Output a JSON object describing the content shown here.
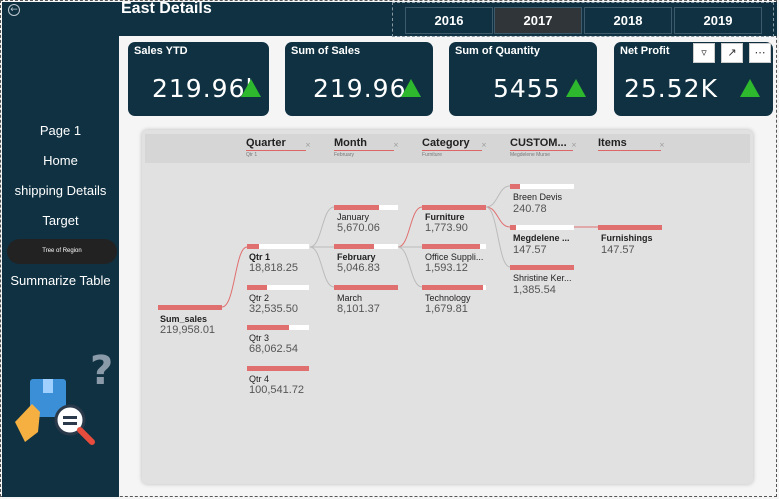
{
  "header": {
    "title": "East Details"
  },
  "years": [
    "2016",
    "2017",
    "2018",
    "2019"
  ],
  "selected_year": "2017",
  "sidebar": {
    "items": [
      {
        "label": "Page 1"
      },
      {
        "label": "Home"
      },
      {
        "label": "shipping Details"
      },
      {
        "label": "Target"
      },
      {
        "label": "Tree of Region"
      },
      {
        "label": "Summarize Table"
      }
    ],
    "selected": "Tree of Region",
    "back_icon": "back-arrow-icon",
    "illustration_icon": "help-search-illustration-icon"
  },
  "cards": [
    {
      "label": "Sales YTD",
      "value": "219.96l"
    },
    {
      "label": "Sum of Sales",
      "value": "219.96"
    },
    {
      "label": "Sum of Quantity",
      "value": "5455"
    },
    {
      "label": "Net Profit",
      "value": "25.52K"
    }
  ],
  "card_trend_icon": "up-triangle-icon",
  "card_trend_color": "#2eb82e",
  "visual_icons": [
    "filter-icon",
    "focus-mode-icon",
    "more-options-icon"
  ],
  "tree": {
    "columns": [
      {
        "label": "Quarter",
        "sub": "Qtr 1"
      },
      {
        "label": "Month",
        "sub": "February"
      },
      {
        "label": "Category",
        "sub": "Furniture"
      },
      {
        "label": "CUSTOM...",
        "sub": "Megdelene Murse"
      },
      {
        "label": "Items",
        "sub": ""
      }
    ],
    "root": {
      "label": "Sum_sales",
      "value": "219,958.01"
    },
    "quarters": [
      {
        "label": "Qtr 1",
        "value": "18,818.25",
        "fill": 0.19
      },
      {
        "label": "Qtr 2",
        "value": "32,535.50",
        "fill": 0.32
      },
      {
        "label": "Qtr 3",
        "value": "68,062.54",
        "fill": 0.68
      },
      {
        "label": "Qtr 4",
        "value": "100,541.72",
        "fill": 1.0
      }
    ],
    "months": [
      {
        "label": "January",
        "value": "5,670.06",
        "fill": 0.7
      },
      {
        "label": "February",
        "value": "5,046.83",
        "fill": 0.62
      },
      {
        "label": "March",
        "value": "8,101.37",
        "fill": 1.0
      }
    ],
    "categories": [
      {
        "label": "Furniture",
        "value": "1,773.90",
        "fill": 1.0
      },
      {
        "label": "Office Suppli...",
        "value": "1,593.12",
        "fill": 0.9
      },
      {
        "label": "Technology",
        "value": "1,679.81",
        "fill": 0.95
      }
    ],
    "customers": [
      {
        "label": "Breen Devis",
        "value": "240.78",
        "fill": 0.16
      },
      {
        "label": "Megdelene ...",
        "value": "147.57",
        "fill": 0.1
      },
      {
        "label": "Shristine Ker...",
        "value": "1,385.54",
        "fill": 1.0
      }
    ],
    "items": [
      {
        "label": "Furnishings",
        "value": "147.57",
        "fill": 1.0
      }
    ],
    "accent_color": "#e07070"
  }
}
